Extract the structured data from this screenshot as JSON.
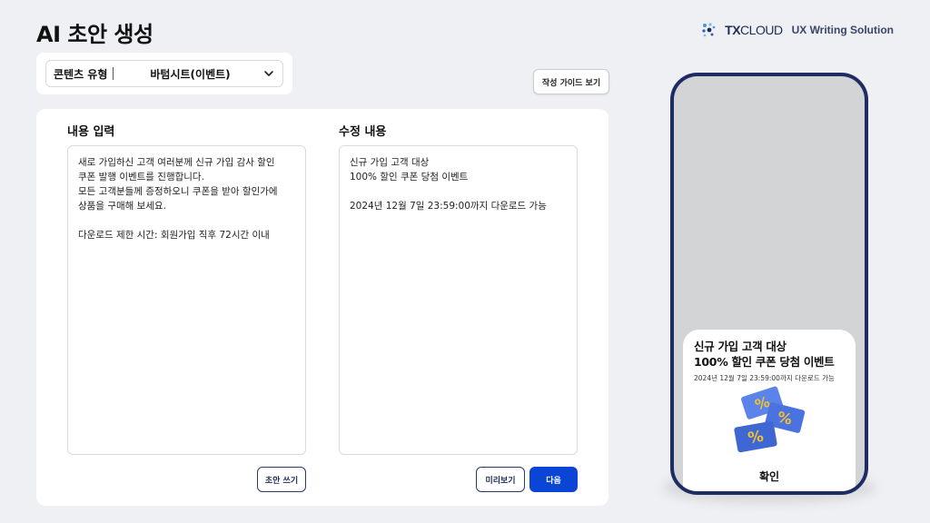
{
  "page": {
    "title": "AI 초안 생성"
  },
  "brand": {
    "name_bold": "TX",
    "name_rest": "CLOUD",
    "subtitle": "UX Writing Solution",
    "accent": "#1e2d55"
  },
  "content_type": {
    "label": "콘텐츠 유형",
    "value": "바텀시트(이벤트)"
  },
  "guide_button": "작성 가이드 보기",
  "input_panel": {
    "title": "내용 입력",
    "text": "새로 가입하신 고객 여러분께 신규 가입 감사 할인\n쿠폰 발행 이벤트를 진행합니다.\n모든 고객분들께 증정하오니 쿠폰을 받아 할인가에\n상품을 구매해 보세요.\n\n다운로드 제한 시간: 회원가입 직후 72시간 이내",
    "draft_button": "초안 쓰기"
  },
  "edit_panel": {
    "title": "수정 내용",
    "text": "신규 가입 고객 대상\n100% 할인 쿠폰 당첨 이벤트\n\n2024년 12월 7일 23:59:00까지 다운로드 가능",
    "preview_button": "미리보기",
    "next_button": "다음"
  },
  "preview": {
    "title_line1": "신규 가입 고객 대상",
    "title_line2": "100% 할인 쿠폰 당첨 이벤트",
    "subtitle": "2024년 12월 7일 23:59:00까지 다운로드 가능",
    "confirm": "확인",
    "coupon_glyph": "%"
  },
  "colors": {
    "primary": "#0a45d6",
    "phone_frame": "#1f2c63",
    "coupon": "#4a73e0",
    "coupon_glyph": "#f2c230"
  }
}
